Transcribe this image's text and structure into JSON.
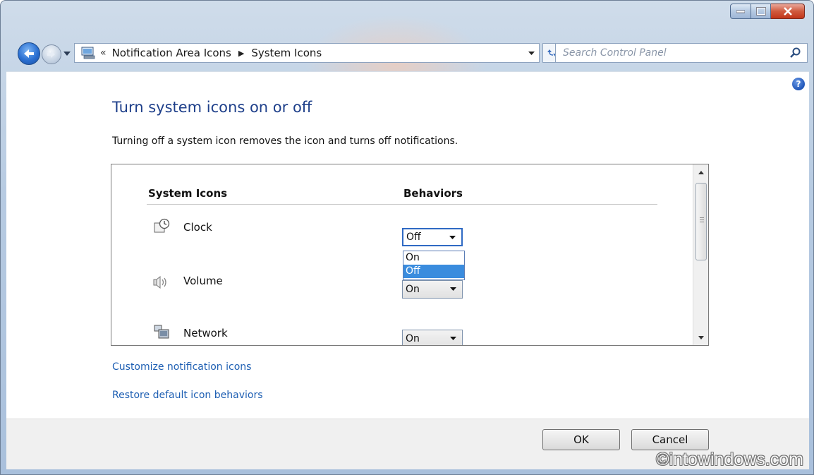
{
  "window": {
    "caption": {
      "minimize": "minimize",
      "maximize": "maximize",
      "close": "close"
    }
  },
  "nav": {
    "breadcrumb": {
      "overflow": "«",
      "items": [
        "Notification Area Icons",
        "System Icons"
      ],
      "separator": "▶"
    },
    "search": {
      "placeholder": "Search Control Panel",
      "value": ""
    }
  },
  "main": {
    "title": "Turn system icons on or off",
    "description": "Turning off a system icon removes the icon and turns off notifications.",
    "columns": {
      "icons": "System Icons",
      "behaviors": "Behaviors"
    },
    "rows": [
      {
        "name": "Clock",
        "icon": "clock-icon",
        "behavior": "Off"
      },
      {
        "name": "Volume",
        "icon": "volume-icon",
        "behavior": "On"
      },
      {
        "name": "Network",
        "icon": "network-icon",
        "behavior": "On"
      }
    ],
    "dropdown_options": [
      "On",
      "Off"
    ],
    "dropdown_selected": "Off",
    "links": {
      "customize": "Customize notification icons",
      "restore": "Restore default icon behaviors"
    }
  },
  "footer": {
    "ok": "OK",
    "cancel": "Cancel",
    "watermark": "©intowindows.com"
  },
  "colors": {
    "title_blue": "#1e3f8a",
    "link_blue": "#1e5fb3",
    "selection_blue": "#3a8cde",
    "close_red": "#c2361a"
  }
}
